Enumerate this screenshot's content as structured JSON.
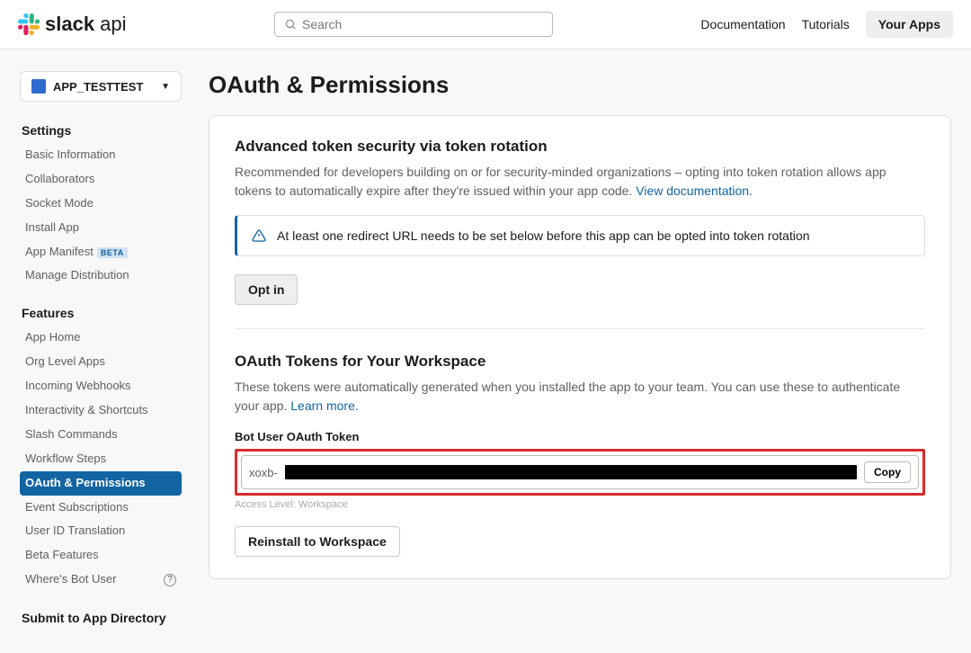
{
  "header": {
    "logo_bold": "slack",
    "logo_light": " api",
    "search_placeholder": "Search",
    "nav": {
      "documentation": "Documentation",
      "tutorials": "Tutorials",
      "your_apps": "Your Apps"
    }
  },
  "sidebar": {
    "app_name": "APP_TESTTEST",
    "settings_heading": "Settings",
    "settings": [
      "Basic Information",
      "Collaborators",
      "Socket Mode",
      "Install App",
      "App Manifest",
      "Manage Distribution"
    ],
    "manifest_badge": "BETA",
    "features_heading": "Features",
    "features": [
      "App Home",
      "Org Level Apps",
      "Incoming Webhooks",
      "Interactivity & Shortcuts",
      "Slash Commands",
      "Workflow Steps",
      "OAuth & Permissions",
      "Event Subscriptions",
      "User ID Translation",
      "Beta Features",
      "Where's Bot User"
    ],
    "active_feature": "OAuth & Permissions",
    "submit_heading": "Submit to App Directory"
  },
  "main": {
    "page_title": "OAuth & Permissions",
    "advanced": {
      "title": "Advanced token security via token rotation",
      "desc": "Recommended for developers building on or for security-minded organizations – opting into token rotation allows app tokens to automatically expire after they're issued within your app code. ",
      "doc_link": "View documentation.",
      "alert": "At least one redirect URL needs to be set below before this app can be opted into token rotation",
      "opt_in_btn": "Opt in"
    },
    "tokens": {
      "title": "OAuth Tokens for Your Workspace",
      "desc": "These tokens were automatically generated when you installed the app to your team. You can use these to authenticate your app. ",
      "learn_link": "Learn more.",
      "bot_label": "Bot User OAuth Token",
      "token_prefix": "xoxb-",
      "copy_btn": "Copy",
      "access_level": "Access Level: Workspace",
      "reinstall_btn": "Reinstall to Workspace"
    }
  }
}
